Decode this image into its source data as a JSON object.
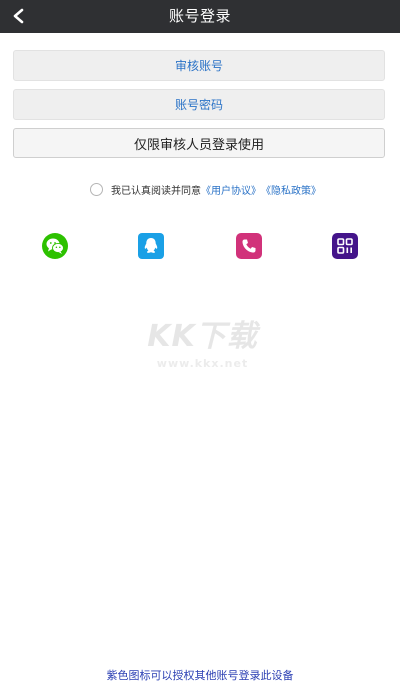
{
  "header": {
    "title": "账号登录",
    "back_icon": "chevron-left-icon"
  },
  "form": {
    "account_placeholder": "审核账号",
    "password_placeholder": "账号密码",
    "login_label": "仅限审核人员登录使用"
  },
  "agreement": {
    "prefix": "我已认真阅读并同意",
    "user_agreement": "《用户协议》",
    "privacy_policy": "《隐私政策》",
    "checked": false
  },
  "social": [
    {
      "name": "wechat",
      "icon": "wechat-icon",
      "color": "#2dc100"
    },
    {
      "name": "qq",
      "icon": "qq-icon",
      "color": "#1aa0e6"
    },
    {
      "name": "phone",
      "icon": "phone-icon",
      "color": "#d1327a"
    },
    {
      "name": "authorize",
      "icon": "grid-authorize-icon",
      "color": "#44148a"
    }
  ],
  "watermark": {
    "brand": "KK下载",
    "site": "www.kkx.net"
  },
  "footer": {
    "hint": "紫色图标可以授权其他账号登录此设备"
  },
  "colors": {
    "header_bg": "#2f3033",
    "link": "#2b73c7",
    "footer_text": "#2b3fb3"
  }
}
